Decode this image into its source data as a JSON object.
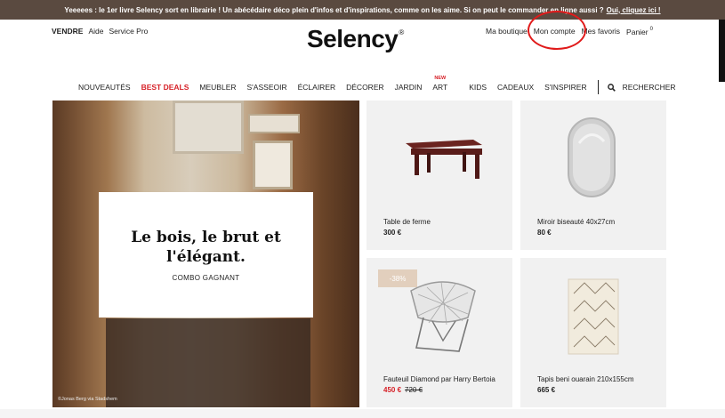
{
  "banner": {
    "text": "Yeeeees  : le 1er livre Selency sort en librairie ! Un abécédaire déco plein d'infos et d'inspirations, comme on les aime. Si on peut le commander en ligne aussi ? ",
    "link": "Oui, cliquez ici !"
  },
  "header": {
    "left": {
      "sell": "VENDRE",
      "help": "Aide",
      "pro": "Service Pro"
    },
    "logo": "Selency",
    "logo_mark": "®",
    "right": {
      "shop": "Ma boutique",
      "account": "Mon compte",
      "favorites": "Mes favoris",
      "cart": "Panier",
      "cart_count": "0"
    }
  },
  "nav": {
    "items": [
      "NOUVEAUTÉS",
      "BEST DEALS",
      "MEUBLER",
      "S'ASSEOIR",
      "ÉCLAIRER",
      "DÉCORER",
      "JARDIN",
      "ART",
      "KIDS",
      "CADEAUX",
      "S'INSPIRER"
    ],
    "art_badge": "NEW",
    "search_label": "RECHERCHER"
  },
  "hero": {
    "title_line1": "Le bois, le brut et",
    "title_line2": "l'élégant.",
    "subtitle": "COMBO GAGNANT",
    "credit": "©Jonas Berg via Stadshem"
  },
  "products": [
    {
      "name": "Table de ferme",
      "price": "300 €"
    },
    {
      "name": "Miroir biseauté 40x27cm",
      "price": "80 €"
    },
    {
      "name": "Fauteuil Diamond par Harry Bertoia",
      "price": "450 €",
      "old_price": "720 €",
      "discount": "-38%"
    },
    {
      "name": "Tapis beni ouarain 210x155cm",
      "price": "665 €"
    }
  ],
  "colors": {
    "accent": "#d61f26",
    "banner": "#5a4a40",
    "highlight_circle": "#e01a1a"
  }
}
